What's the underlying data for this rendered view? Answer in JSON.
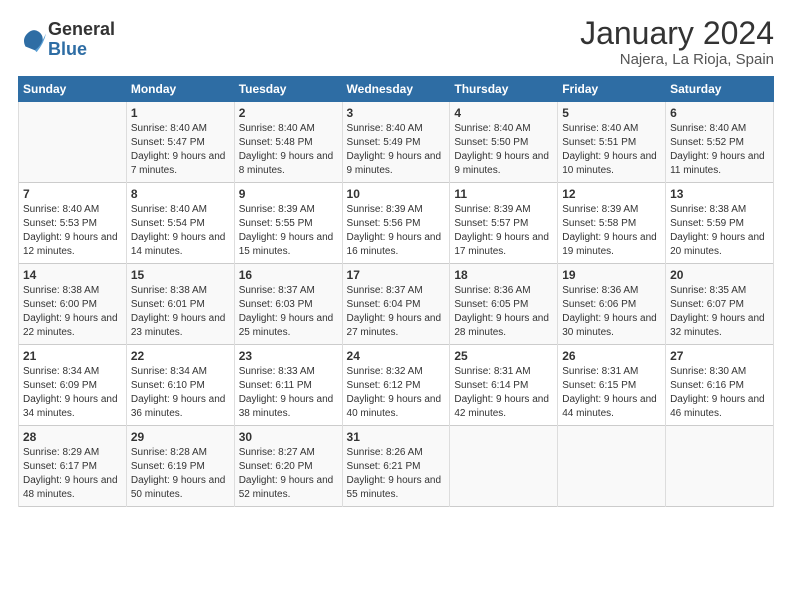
{
  "logo": {
    "general": "General",
    "blue": "Blue"
  },
  "title": "January 2024",
  "location": "Najera, La Rioja, Spain",
  "days_header": [
    "Sunday",
    "Monday",
    "Tuesday",
    "Wednesday",
    "Thursday",
    "Friday",
    "Saturday"
  ],
  "weeks": [
    [
      {
        "day": "",
        "sunrise": "",
        "sunset": "",
        "daylight": ""
      },
      {
        "day": "1",
        "sunrise": "Sunrise: 8:40 AM",
        "sunset": "Sunset: 5:47 PM",
        "daylight": "Daylight: 9 hours and 7 minutes."
      },
      {
        "day": "2",
        "sunrise": "Sunrise: 8:40 AM",
        "sunset": "Sunset: 5:48 PM",
        "daylight": "Daylight: 9 hours and 8 minutes."
      },
      {
        "day": "3",
        "sunrise": "Sunrise: 8:40 AM",
        "sunset": "Sunset: 5:49 PM",
        "daylight": "Daylight: 9 hours and 9 minutes."
      },
      {
        "day": "4",
        "sunrise": "Sunrise: 8:40 AM",
        "sunset": "Sunset: 5:50 PM",
        "daylight": "Daylight: 9 hours and 9 minutes."
      },
      {
        "day": "5",
        "sunrise": "Sunrise: 8:40 AM",
        "sunset": "Sunset: 5:51 PM",
        "daylight": "Daylight: 9 hours and 10 minutes."
      },
      {
        "day": "6",
        "sunrise": "Sunrise: 8:40 AM",
        "sunset": "Sunset: 5:52 PM",
        "daylight": "Daylight: 9 hours and 11 minutes."
      }
    ],
    [
      {
        "day": "7",
        "sunrise": "Sunrise: 8:40 AM",
        "sunset": "Sunset: 5:53 PM",
        "daylight": "Daylight: 9 hours and 12 minutes."
      },
      {
        "day": "8",
        "sunrise": "Sunrise: 8:40 AM",
        "sunset": "Sunset: 5:54 PM",
        "daylight": "Daylight: 9 hours and 14 minutes."
      },
      {
        "day": "9",
        "sunrise": "Sunrise: 8:39 AM",
        "sunset": "Sunset: 5:55 PM",
        "daylight": "Daylight: 9 hours and 15 minutes."
      },
      {
        "day": "10",
        "sunrise": "Sunrise: 8:39 AM",
        "sunset": "Sunset: 5:56 PM",
        "daylight": "Daylight: 9 hours and 16 minutes."
      },
      {
        "day": "11",
        "sunrise": "Sunrise: 8:39 AM",
        "sunset": "Sunset: 5:57 PM",
        "daylight": "Daylight: 9 hours and 17 minutes."
      },
      {
        "day": "12",
        "sunrise": "Sunrise: 8:39 AM",
        "sunset": "Sunset: 5:58 PM",
        "daylight": "Daylight: 9 hours and 19 minutes."
      },
      {
        "day": "13",
        "sunrise": "Sunrise: 8:38 AM",
        "sunset": "Sunset: 5:59 PM",
        "daylight": "Daylight: 9 hours and 20 minutes."
      }
    ],
    [
      {
        "day": "14",
        "sunrise": "Sunrise: 8:38 AM",
        "sunset": "Sunset: 6:00 PM",
        "daylight": "Daylight: 9 hours and 22 minutes."
      },
      {
        "day": "15",
        "sunrise": "Sunrise: 8:38 AM",
        "sunset": "Sunset: 6:01 PM",
        "daylight": "Daylight: 9 hours and 23 minutes."
      },
      {
        "day": "16",
        "sunrise": "Sunrise: 8:37 AM",
        "sunset": "Sunset: 6:03 PM",
        "daylight": "Daylight: 9 hours and 25 minutes."
      },
      {
        "day": "17",
        "sunrise": "Sunrise: 8:37 AM",
        "sunset": "Sunset: 6:04 PM",
        "daylight": "Daylight: 9 hours and 27 minutes."
      },
      {
        "day": "18",
        "sunrise": "Sunrise: 8:36 AM",
        "sunset": "Sunset: 6:05 PM",
        "daylight": "Daylight: 9 hours and 28 minutes."
      },
      {
        "day": "19",
        "sunrise": "Sunrise: 8:36 AM",
        "sunset": "Sunset: 6:06 PM",
        "daylight": "Daylight: 9 hours and 30 minutes."
      },
      {
        "day": "20",
        "sunrise": "Sunrise: 8:35 AM",
        "sunset": "Sunset: 6:07 PM",
        "daylight": "Daylight: 9 hours and 32 minutes."
      }
    ],
    [
      {
        "day": "21",
        "sunrise": "Sunrise: 8:34 AM",
        "sunset": "Sunset: 6:09 PM",
        "daylight": "Daylight: 9 hours and 34 minutes."
      },
      {
        "day": "22",
        "sunrise": "Sunrise: 8:34 AM",
        "sunset": "Sunset: 6:10 PM",
        "daylight": "Daylight: 9 hours and 36 minutes."
      },
      {
        "day": "23",
        "sunrise": "Sunrise: 8:33 AM",
        "sunset": "Sunset: 6:11 PM",
        "daylight": "Daylight: 9 hours and 38 minutes."
      },
      {
        "day": "24",
        "sunrise": "Sunrise: 8:32 AM",
        "sunset": "Sunset: 6:12 PM",
        "daylight": "Daylight: 9 hours and 40 minutes."
      },
      {
        "day": "25",
        "sunrise": "Sunrise: 8:31 AM",
        "sunset": "Sunset: 6:14 PM",
        "daylight": "Daylight: 9 hours and 42 minutes."
      },
      {
        "day": "26",
        "sunrise": "Sunrise: 8:31 AM",
        "sunset": "Sunset: 6:15 PM",
        "daylight": "Daylight: 9 hours and 44 minutes."
      },
      {
        "day": "27",
        "sunrise": "Sunrise: 8:30 AM",
        "sunset": "Sunset: 6:16 PM",
        "daylight": "Daylight: 9 hours and 46 minutes."
      }
    ],
    [
      {
        "day": "28",
        "sunrise": "Sunrise: 8:29 AM",
        "sunset": "Sunset: 6:17 PM",
        "daylight": "Daylight: 9 hours and 48 minutes."
      },
      {
        "day": "29",
        "sunrise": "Sunrise: 8:28 AM",
        "sunset": "Sunset: 6:19 PM",
        "daylight": "Daylight: 9 hours and 50 minutes."
      },
      {
        "day": "30",
        "sunrise": "Sunrise: 8:27 AM",
        "sunset": "Sunset: 6:20 PM",
        "daylight": "Daylight: 9 hours and 52 minutes."
      },
      {
        "day": "31",
        "sunrise": "Sunrise: 8:26 AM",
        "sunset": "Sunset: 6:21 PM",
        "daylight": "Daylight: 9 hours and 55 minutes."
      },
      {
        "day": "",
        "sunrise": "",
        "sunset": "",
        "daylight": ""
      },
      {
        "day": "",
        "sunrise": "",
        "sunset": "",
        "daylight": ""
      },
      {
        "day": "",
        "sunrise": "",
        "sunset": "",
        "daylight": ""
      }
    ]
  ]
}
